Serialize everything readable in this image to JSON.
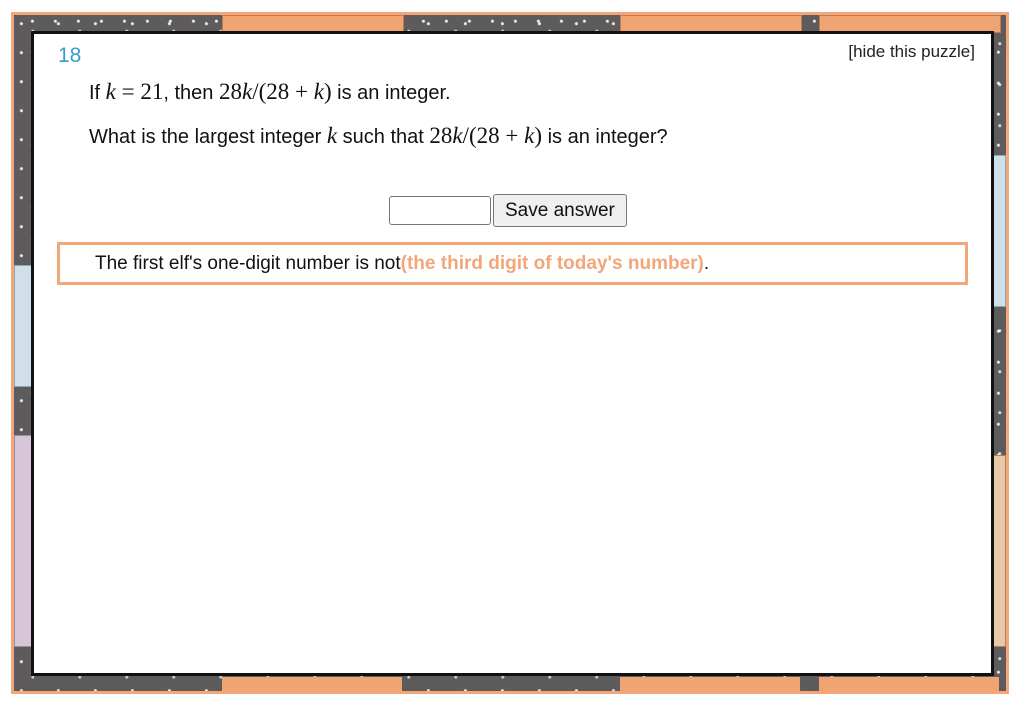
{
  "puzzle": {
    "number": "18",
    "hide_label": "[hide this puzzle]"
  },
  "question": {
    "line1": {
      "prefix": "If ",
      "var_k": "k",
      "equals_21": " = 21",
      "then": ", then ",
      "expr_a": "28",
      "expr_k": "k",
      "expr_b": "/(28 + ",
      "expr_k2": "k",
      "expr_c": ")",
      "suffix": " is an integer."
    },
    "line2": {
      "prefix": "What is the largest integer ",
      "var_k": "k",
      "middle": " such that ",
      "expr_a": "28",
      "expr_k": "k",
      "expr_b": "/(28 + ",
      "expr_k2": "k",
      "expr_c": ")",
      "suffix": " is an integer?"
    }
  },
  "answer": {
    "value": "",
    "placeholder": "",
    "save_label": "Save answer"
  },
  "clue": {
    "prefix": "The first elf's one-digit number is not ",
    "highlight": "(the third digit of today's number)",
    "suffix": "."
  },
  "colors": {
    "accent": "#f2a679",
    "number": "#3a9dc9",
    "panel_border": "#111111"
  }
}
